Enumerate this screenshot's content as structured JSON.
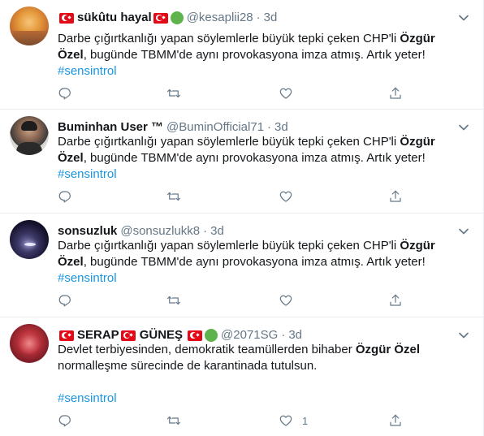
{
  "tweets": [
    {
      "name": "sükûtu hayal",
      "handle": "@kesaplii28",
      "time": "3d",
      "text_pre": "Darbe çığırtkanlığı yapan söylemlerle büyük tepki çeken CHP'li ",
      "text_bold": "Özgür Özel",
      "text_post": ", bugünde TBMM'de aynı provokasyona imza atmış. Artık yeter!",
      "hashtag": "#sensintrol",
      "like_count": ""
    },
    {
      "name": "Buminhan User ™",
      "handle": "@BuminOfficial71",
      "time": "3d",
      "text_pre": "Darbe çığırtkanlığı yapan söylemlerle büyük tepki çeken CHP'li ",
      "text_bold": "Özgür Özel",
      "text_post": ", bugünde TBMM'de aynı provokasyona imza atmış. Artık yeter!",
      "hashtag": "#sensintrol",
      "like_count": ""
    },
    {
      "name": "sonsuzluk",
      "handle": "@sonsuzlukk8",
      "time": "3d",
      "text_pre": "Darbe çığırtkanlığı yapan söylemlerle büyük tepki çeken CHP'li ",
      "text_bold": "Özgür Özel",
      "text_post": ", bugünde TBMM'de aynı provokasyona imza atmış. Artık yeter!",
      "hashtag": "#sensintrol",
      "like_count": ""
    },
    {
      "name_a": "SERAP",
      "name_b": "GÜNEŞ",
      "handle": "@2071SG",
      "time": "3d",
      "text_pre": "Devlet terbiyesinden, demokratik teamüllerden bihaber ",
      "text_bold": "Özgür Özel",
      "text_post": " normalleşme sürecinde de karantinada tutulsun.",
      "hashtag": "#sensintrol",
      "like_count": "1"
    }
  ],
  "separator": "·",
  "icons": [
    "reply-icon",
    "retweet-icon",
    "like-icon",
    "share-icon",
    "chevron-down-icon",
    "turkey-flag-icon",
    "green-circle-icon"
  ],
  "colors": {
    "link": "#1b95e0",
    "secondary": "#657786",
    "flag": "#e30a17",
    "green": "#5fb34c"
  }
}
